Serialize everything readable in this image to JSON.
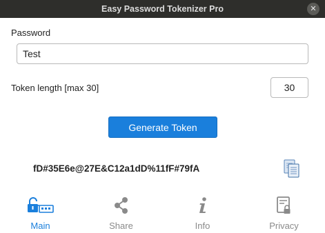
{
  "window": {
    "title": "Easy Password Tokenizer Pro",
    "close_glyph": "✕"
  },
  "form": {
    "password_label": "Password",
    "password_value": "Test",
    "length_label": "Token length [max 30]",
    "length_value": "30",
    "generate_label": "Generate Token"
  },
  "result": {
    "token": "fD#35E6e@27E&C12a1dD%11fF#79fA",
    "copy_icon": "copy-icon"
  },
  "nav": {
    "items": [
      {
        "label": "Main",
        "icon": "lock-keyboard-icon",
        "active": true
      },
      {
        "label": "Share",
        "icon": "share-icon",
        "active": false
      },
      {
        "label": "Info",
        "icon": "info-icon",
        "active": false
      },
      {
        "label": "Privacy",
        "icon": "privacy-icon",
        "active": false
      }
    ]
  },
  "colors": {
    "accent": "#1a7fdc",
    "titlebar": "#2e2e2b",
    "inactive": "#8a8a8a"
  }
}
